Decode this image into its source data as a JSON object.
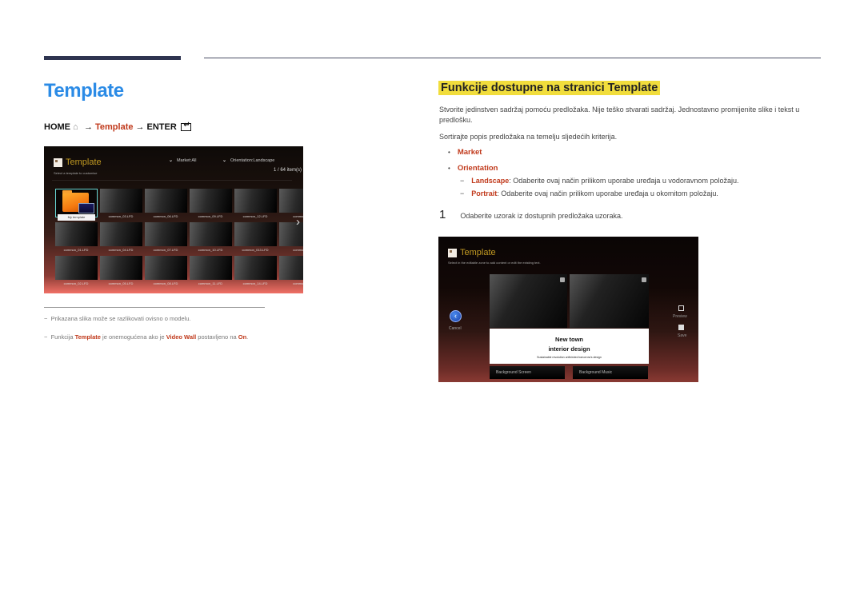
{
  "page": {
    "title": "Template",
    "breadcrumb": {
      "home": "HOME",
      "arrow1": "→",
      "template": "Template",
      "arrow2": "→",
      "enter": "ENTER"
    }
  },
  "screen1": {
    "title": "Template",
    "subtitle": "Select a template to customise",
    "filter_market": "Market:All",
    "filter_orientation": "Orientation:Landscape",
    "count": "1 / 64 item(s)",
    "my_template_label": "My template",
    "thumbnails": [
      [
        "common_03.LFD",
        "common_06.LFD",
        "common_09.LFD",
        "common_12.LFD",
        "common_"
      ],
      [
        "common_01.LFD",
        "common_04.LFD",
        "common_07.LFD",
        "common_10.LFD",
        "common_013.LFD",
        "common_"
      ],
      [
        "common_02.LFD",
        "common_05.LFD",
        "common_08.LFD",
        "common_11.LFD",
        "common_14.LFD",
        "common_"
      ]
    ]
  },
  "footnotes": {
    "note1": "Prikazana slika može se razlikovati ovisno o modelu.",
    "note2_pre": "Funkcija ",
    "note2_b1": "Template",
    "note2_mid": " je onemogućena ako je ",
    "note2_b2": "Video Wall",
    "note2_mid2": " postavljeno na ",
    "note2_b3": "On",
    "note2_end": ".",
    "dash": "−"
  },
  "section": {
    "title": "Funkcije dostupne na stranici Template",
    "para1": "Stvorite jedinstven sadržaj pomoću predložaka. Nije teško stvarati sadržaj. Jednostavno promijenite slike i tekst u predlošku.",
    "para2": "Sortirajte popis predložaka na temelju sljedećih kriterija.",
    "bullets": [
      {
        "dot": "•",
        "label": "Market"
      },
      {
        "dot": "•",
        "label": "Orientation"
      }
    ],
    "sub_items": [
      {
        "dash": "−",
        "label": "Landscape",
        "text": ": Odaberite ovaj način prilikom uporabe uređaja u vodoravnom položaju."
      },
      {
        "dash": "−",
        "label": "Portrait",
        "text": ": Odaberite ovaj način prilikom uporabe uređaja u okomitom položaju."
      }
    ],
    "step": {
      "number": "1",
      "text": "Odaberite uzorak iz dostupnih predložaka uzoraka."
    }
  },
  "screen2": {
    "title": "Template",
    "subtitle": "Select in the editable zone to add content or edit the existing text.",
    "card_line1": "New town",
    "card_line2": "interior design",
    "card_line3": "Sustainable revolution unfinished tomorrow's design",
    "cancel_label": "Cancel",
    "preview_label": "Preview",
    "save_label": "Save",
    "bg_screen_label": "Background Screen",
    "bg_music_label": "Background Music"
  }
}
